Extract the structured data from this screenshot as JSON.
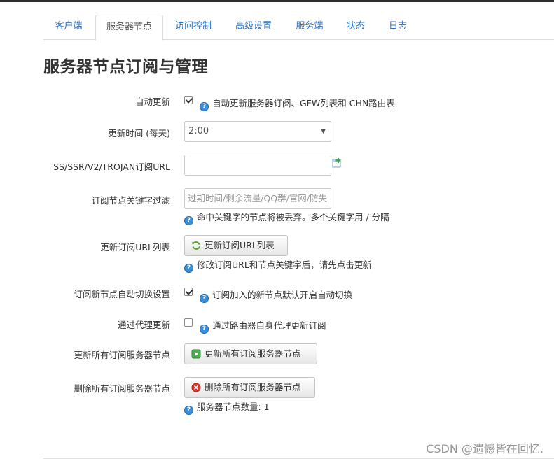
{
  "tabs": [
    {
      "label": "客户端",
      "active": false
    },
    {
      "label": "服务器节点",
      "active": true
    },
    {
      "label": "访问控制",
      "active": false
    },
    {
      "label": "高级设置",
      "active": false
    },
    {
      "label": "服务端",
      "active": false
    },
    {
      "label": "状态",
      "active": false
    },
    {
      "label": "日志",
      "active": false
    }
  ],
  "page_title": "服务器节点订阅与管理",
  "fields": {
    "auto_update": {
      "label": "自动更新",
      "checked": true,
      "help": "自动更新服务器订阅、GFW列表和 CHN路由表"
    },
    "update_time": {
      "label": "更新时间 (每天)",
      "value": "2:00"
    },
    "subscribe_url": {
      "label": "SS/SSR/V2/TROJAN订阅URL",
      "value": "",
      "add_icon": "add-entry-icon"
    },
    "keyword_filter": {
      "label": "订阅节点关键字过滤",
      "placeholder": "过期时间/剩余流量/QQ群/官网/防失",
      "help": "命中关键字的节点将被丢弃。多个关键字用 / 分隔"
    },
    "update_url_list": {
      "label": "更新订阅URL列表",
      "button": "更新订阅URL列表",
      "button_icon": "refresh-icon",
      "help": "修改订阅URL和节点关键字后，请先点击更新"
    },
    "auto_switch": {
      "label": "订阅新节点自动切换设置",
      "checked": true,
      "help": "订阅加入的新节点默认开启自动切换"
    },
    "proxy_update": {
      "label": "通过代理更新",
      "checked": false,
      "help": "通过路由器自身代理更新订阅"
    },
    "update_all": {
      "label": "更新所有订阅服务器节点",
      "button": "更新所有订阅服务器节点",
      "button_icon": "play-icon"
    },
    "delete_all": {
      "label": "删除所有订阅服务器节点",
      "button": "删除所有订阅服务器节点",
      "button_icon": "delete-icon",
      "help": "服务器节点数量: 1"
    }
  },
  "watermark": "CSDN @遗憾皆在回忆.",
  "colors": {
    "link": "#2f6fbe",
    "help_icon": "#3b8fd9",
    "delete_icon": "#d9342b",
    "play_icon": "#4cae4c",
    "refresh_icon": "#5aa02c"
  }
}
